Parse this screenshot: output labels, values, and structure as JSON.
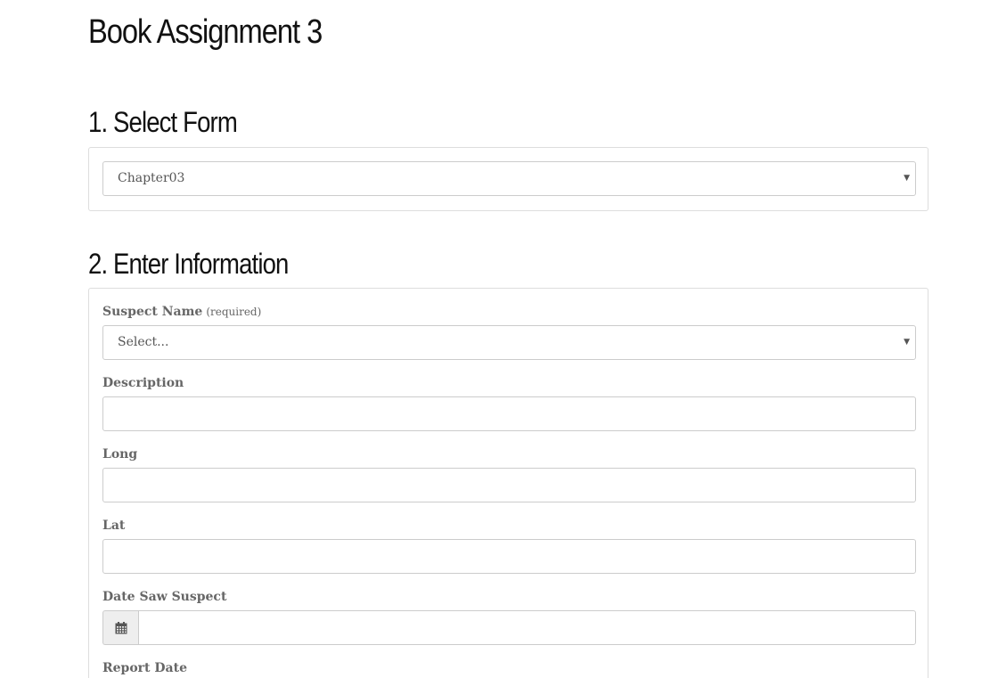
{
  "page": {
    "title": "Book Assignment 3"
  },
  "select_form": {
    "heading": "1. Select Form",
    "selected_value": "Chapter03"
  },
  "enter_info": {
    "heading": "2. Enter Information",
    "suspect_name": {
      "label": "Suspect Name",
      "hint": "(required)",
      "selected_value": "Select..."
    },
    "description": {
      "label": "Description",
      "value": ""
    },
    "long": {
      "label": "Long",
      "value": ""
    },
    "lat": {
      "label": "Lat",
      "value": ""
    },
    "date_saw_suspect": {
      "label": "Date Saw Suspect",
      "value": "",
      "icon": "calendar-icon"
    },
    "report_date": {
      "label": "Report Date"
    }
  },
  "colors": {
    "border": "#cccccc",
    "panel_border": "#dddddd",
    "label": "#666666",
    "addon_bg": "#eeeeee"
  }
}
